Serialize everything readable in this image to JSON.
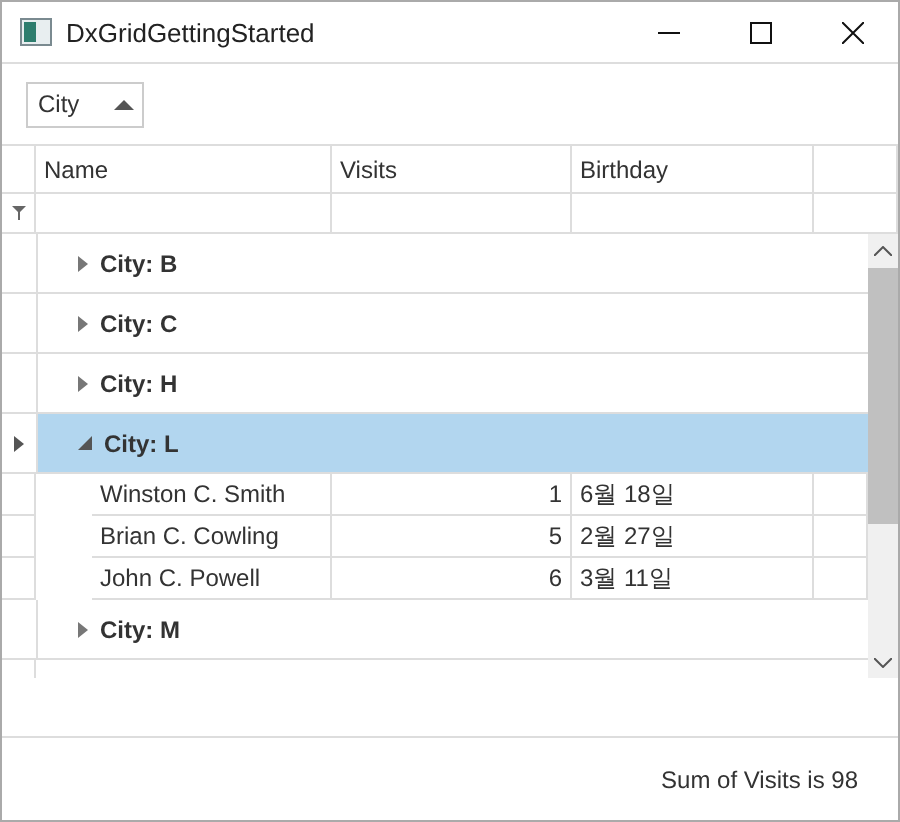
{
  "window": {
    "title": "DxGridGettingStarted"
  },
  "group_panel": {
    "chips": [
      {
        "label": "City",
        "sort_ascending": true
      }
    ]
  },
  "columns": [
    "Name",
    "Visits",
    "Birthday"
  ],
  "groups": [
    {
      "label": "City: B",
      "expanded": false,
      "selected": false
    },
    {
      "label": "City: C",
      "expanded": false,
      "selected": false
    },
    {
      "label": "City: H",
      "expanded": false,
      "selected": false
    },
    {
      "label": "City: L",
      "expanded": true,
      "selected": true,
      "rows": [
        {
          "name": "Winston C. Smith",
          "visits": "1",
          "birthday": "6월 18일"
        },
        {
          "name": "Brian C. Cowling",
          "visits": "5",
          "birthday": "2월 27일"
        },
        {
          "name": "John C. Powell",
          "visits": "6",
          "birthday": "3월 11일"
        }
      ]
    },
    {
      "label": "City: M",
      "expanded": false,
      "selected": false
    }
  ],
  "summary": "Sum of Visits is 98"
}
